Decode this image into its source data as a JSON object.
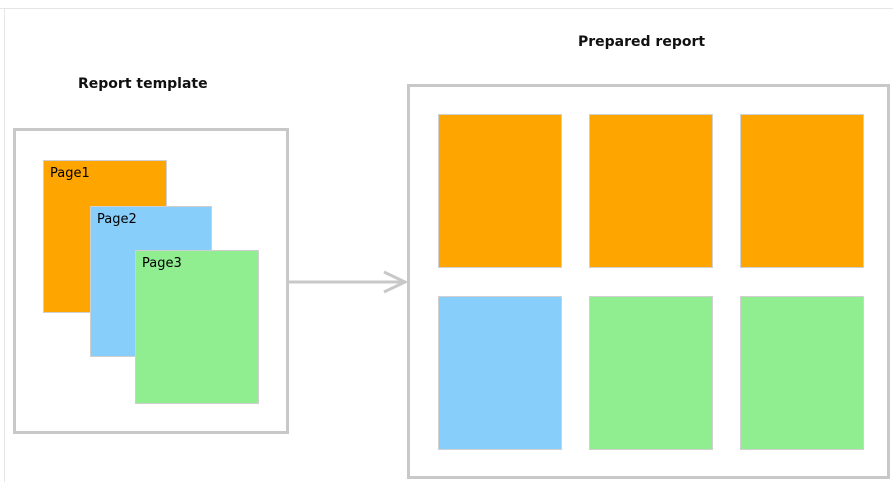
{
  "template": {
    "title": "Report template",
    "pages": [
      {
        "label": "Page1",
        "color": "#FFA500"
      },
      {
        "label": "Page2",
        "color": "#87CEFA"
      },
      {
        "label": "Page3",
        "color": "#90EE90"
      }
    ]
  },
  "prepared": {
    "title": "Prepared report",
    "pages": [
      {
        "color": "#FFA500"
      },
      {
        "color": "#FFA500"
      },
      {
        "color": "#FFA500"
      },
      {
        "color": "#87CEFA"
      },
      {
        "color": "#90EE90"
      },
      {
        "color": "#90EE90"
      }
    ]
  },
  "colors": {
    "frame_border": "#C8C8C8",
    "arrow": "#C8C8C8"
  }
}
